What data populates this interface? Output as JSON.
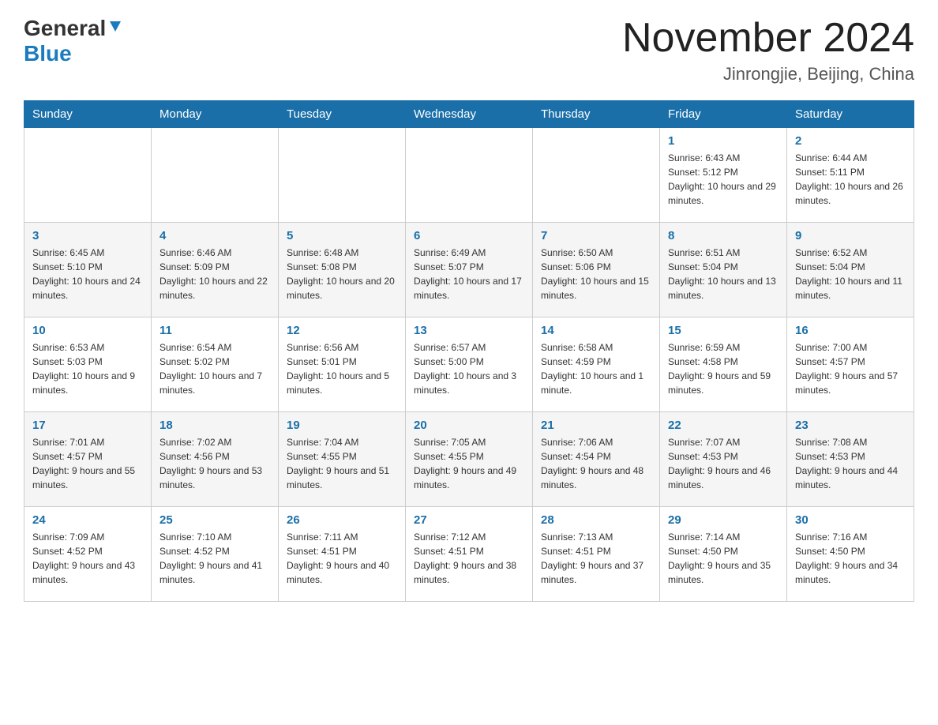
{
  "header": {
    "logo_general": "General",
    "logo_blue": "Blue",
    "month_title": "November 2024",
    "location": "Jinrongjie, Beijing, China"
  },
  "days_of_week": [
    "Sunday",
    "Monday",
    "Tuesday",
    "Wednesday",
    "Thursday",
    "Friday",
    "Saturday"
  ],
  "weeks": [
    {
      "days": [
        {
          "num": "",
          "info": ""
        },
        {
          "num": "",
          "info": ""
        },
        {
          "num": "",
          "info": ""
        },
        {
          "num": "",
          "info": ""
        },
        {
          "num": "",
          "info": ""
        },
        {
          "num": "1",
          "info": "Sunrise: 6:43 AM\nSunset: 5:12 PM\nDaylight: 10 hours and 29 minutes."
        },
        {
          "num": "2",
          "info": "Sunrise: 6:44 AM\nSunset: 5:11 PM\nDaylight: 10 hours and 26 minutes."
        }
      ]
    },
    {
      "days": [
        {
          "num": "3",
          "info": "Sunrise: 6:45 AM\nSunset: 5:10 PM\nDaylight: 10 hours and 24 minutes."
        },
        {
          "num": "4",
          "info": "Sunrise: 6:46 AM\nSunset: 5:09 PM\nDaylight: 10 hours and 22 minutes."
        },
        {
          "num": "5",
          "info": "Sunrise: 6:48 AM\nSunset: 5:08 PM\nDaylight: 10 hours and 20 minutes."
        },
        {
          "num": "6",
          "info": "Sunrise: 6:49 AM\nSunset: 5:07 PM\nDaylight: 10 hours and 17 minutes."
        },
        {
          "num": "7",
          "info": "Sunrise: 6:50 AM\nSunset: 5:06 PM\nDaylight: 10 hours and 15 minutes."
        },
        {
          "num": "8",
          "info": "Sunrise: 6:51 AM\nSunset: 5:04 PM\nDaylight: 10 hours and 13 minutes."
        },
        {
          "num": "9",
          "info": "Sunrise: 6:52 AM\nSunset: 5:04 PM\nDaylight: 10 hours and 11 minutes."
        }
      ]
    },
    {
      "days": [
        {
          "num": "10",
          "info": "Sunrise: 6:53 AM\nSunset: 5:03 PM\nDaylight: 10 hours and 9 minutes."
        },
        {
          "num": "11",
          "info": "Sunrise: 6:54 AM\nSunset: 5:02 PM\nDaylight: 10 hours and 7 minutes."
        },
        {
          "num": "12",
          "info": "Sunrise: 6:56 AM\nSunset: 5:01 PM\nDaylight: 10 hours and 5 minutes."
        },
        {
          "num": "13",
          "info": "Sunrise: 6:57 AM\nSunset: 5:00 PM\nDaylight: 10 hours and 3 minutes."
        },
        {
          "num": "14",
          "info": "Sunrise: 6:58 AM\nSunset: 4:59 PM\nDaylight: 10 hours and 1 minute."
        },
        {
          "num": "15",
          "info": "Sunrise: 6:59 AM\nSunset: 4:58 PM\nDaylight: 9 hours and 59 minutes."
        },
        {
          "num": "16",
          "info": "Sunrise: 7:00 AM\nSunset: 4:57 PM\nDaylight: 9 hours and 57 minutes."
        }
      ]
    },
    {
      "days": [
        {
          "num": "17",
          "info": "Sunrise: 7:01 AM\nSunset: 4:57 PM\nDaylight: 9 hours and 55 minutes."
        },
        {
          "num": "18",
          "info": "Sunrise: 7:02 AM\nSunset: 4:56 PM\nDaylight: 9 hours and 53 minutes."
        },
        {
          "num": "19",
          "info": "Sunrise: 7:04 AM\nSunset: 4:55 PM\nDaylight: 9 hours and 51 minutes."
        },
        {
          "num": "20",
          "info": "Sunrise: 7:05 AM\nSunset: 4:55 PM\nDaylight: 9 hours and 49 minutes."
        },
        {
          "num": "21",
          "info": "Sunrise: 7:06 AM\nSunset: 4:54 PM\nDaylight: 9 hours and 48 minutes."
        },
        {
          "num": "22",
          "info": "Sunrise: 7:07 AM\nSunset: 4:53 PM\nDaylight: 9 hours and 46 minutes."
        },
        {
          "num": "23",
          "info": "Sunrise: 7:08 AM\nSunset: 4:53 PM\nDaylight: 9 hours and 44 minutes."
        }
      ]
    },
    {
      "days": [
        {
          "num": "24",
          "info": "Sunrise: 7:09 AM\nSunset: 4:52 PM\nDaylight: 9 hours and 43 minutes."
        },
        {
          "num": "25",
          "info": "Sunrise: 7:10 AM\nSunset: 4:52 PM\nDaylight: 9 hours and 41 minutes."
        },
        {
          "num": "26",
          "info": "Sunrise: 7:11 AM\nSunset: 4:51 PM\nDaylight: 9 hours and 40 minutes."
        },
        {
          "num": "27",
          "info": "Sunrise: 7:12 AM\nSunset: 4:51 PM\nDaylight: 9 hours and 38 minutes."
        },
        {
          "num": "28",
          "info": "Sunrise: 7:13 AM\nSunset: 4:51 PM\nDaylight: 9 hours and 37 minutes."
        },
        {
          "num": "29",
          "info": "Sunrise: 7:14 AM\nSunset: 4:50 PM\nDaylight: 9 hours and 35 minutes."
        },
        {
          "num": "30",
          "info": "Sunrise: 7:16 AM\nSunset: 4:50 PM\nDaylight: 9 hours and 34 minutes."
        }
      ]
    }
  ]
}
